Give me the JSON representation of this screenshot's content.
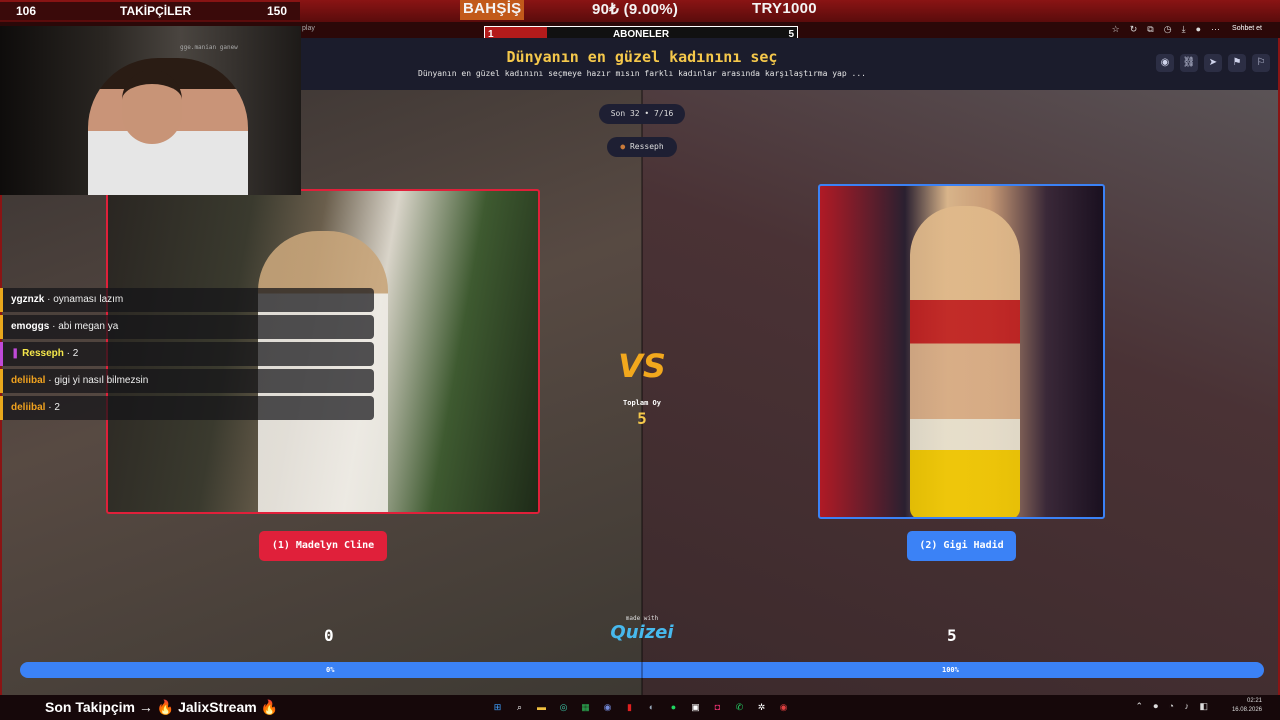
{
  "stream": {
    "followers_current": "106",
    "followers_label": "TAKİPÇİLER",
    "followers_goal": "150",
    "donation_label": "BAHŞİŞ",
    "donation_amount": "90₺ (9.00%)",
    "donation_goal": "TRY1000",
    "subs_current": "1",
    "subs_label": "ABONELER",
    "subs_goal": "5",
    "subs_progress": 0.2,
    "cam_caption": "gge.manian ganew",
    "follow_text": "Son Takipçim → 🔥 JalixStream 🔥"
  },
  "browser": {
    "tab_text": "play",
    "chat_button": "Sohbet et"
  },
  "quiz": {
    "title": "Dünyanın en güzel kadınını seç",
    "subtitle": "Dünyanın en güzel kadınını seçmeye hazır mısın farklı kadınlar arasında karşılaştırma yap ...",
    "round": "Son 32 • 7/16",
    "author": "Resseph",
    "vs_text": "VS",
    "total_votes_label": "Toplam Oy",
    "total_votes": "5",
    "left": {
      "button": "(1) Madelyn Cline",
      "votes": "0",
      "percent": "0%"
    },
    "right": {
      "button": "(2) Gigi Hadid",
      "votes": "5",
      "percent": "100%"
    },
    "made_with": "made with",
    "brand": "Quizei",
    "header_icons": [
      "eye-icon",
      "link-icon",
      "send-icon",
      "flag-icon",
      "flag-outline-icon"
    ]
  },
  "chat": [
    {
      "user": "ygznzk",
      "msg": "· oynaması lazım",
      "color": "#ffffff"
    },
    {
      "user": "emoggs",
      "msg": "· abi megan ya",
      "color": "#ffffff"
    },
    {
      "user": "Resseph",
      "msg": "· 2",
      "color": "#f5e74b"
    },
    {
      "user": "deliibal",
      "msg": "· gigi yi nasıl bilmezsin",
      "color": "#f0a21f"
    },
    {
      "user": "deliibal",
      "msg": "· 2",
      "color": "#f0a21f"
    }
  ],
  "tray": {
    "time": "02:21",
    "date": "16.08.2026"
  },
  "colors": {
    "accent_red": "#e0203a",
    "accent_blue": "#3b82f6",
    "title_yellow": "#f5c84b"
  }
}
